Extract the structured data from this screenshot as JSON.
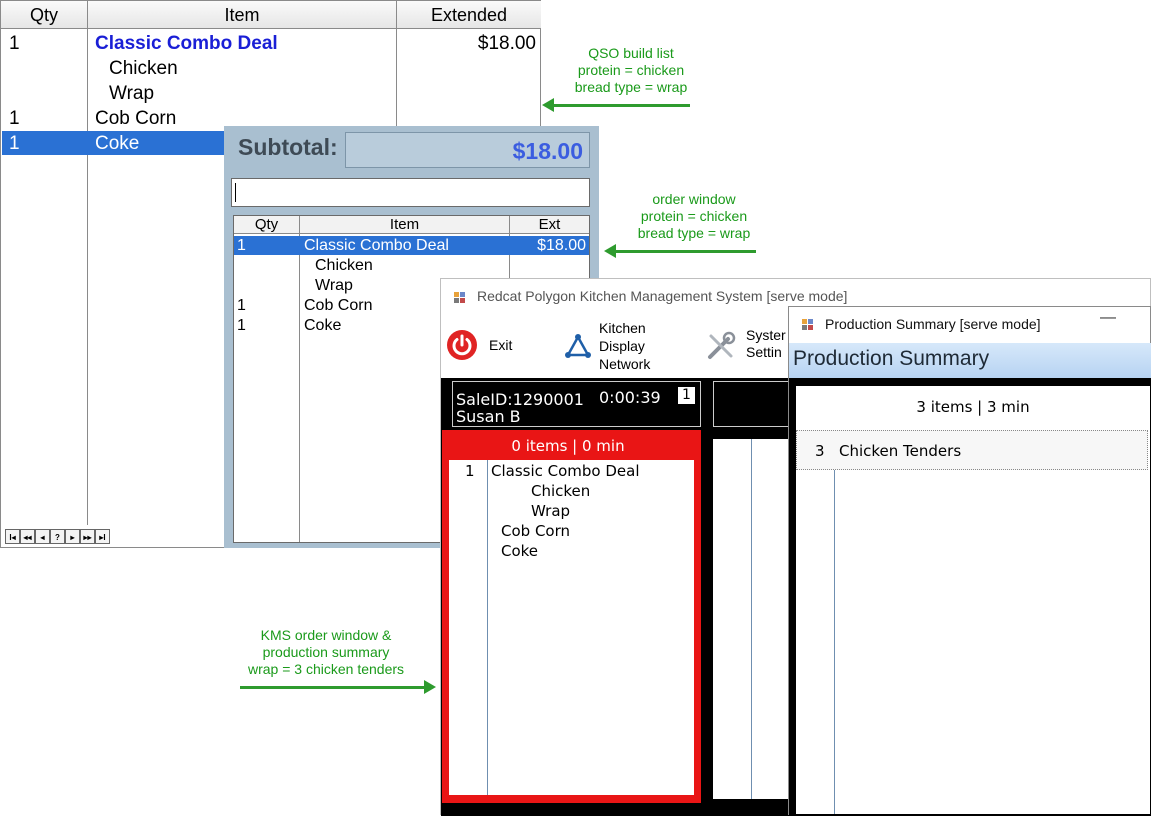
{
  "build_list": {
    "headers": [
      "Qty",
      "Item",
      "Extended"
    ],
    "rows": [
      {
        "qty": "1",
        "item": "Classic Combo Deal",
        "extended": "$18.00"
      },
      {
        "qty": "",
        "item": "Chicken",
        "extended": ""
      },
      {
        "qty": "",
        "item": "Wrap",
        "extended": ""
      },
      {
        "qty": "1",
        "item": "Cob Corn",
        "extended": ""
      },
      {
        "qty": "1",
        "item": "Coke",
        "extended": ""
      }
    ],
    "nav_buttons": [
      "I◂",
      "◂◂",
      "◂",
      "?",
      "▸",
      "▸▸",
      "▸I"
    ]
  },
  "order_window": {
    "subtotal_label": "Subtotal:",
    "subtotal_value": "$18.00",
    "headers": [
      "Qty",
      "Item",
      "Ext"
    ],
    "rows": [
      {
        "qty": "1",
        "item": "Classic Combo Deal",
        "ext": "$18.00"
      },
      {
        "qty": "",
        "item": "Chicken",
        "ext": ""
      },
      {
        "qty": "",
        "item": "Wrap",
        "ext": ""
      },
      {
        "qty": "1",
        "item": "Cob Corn",
        "ext": ""
      },
      {
        "qty": "1",
        "item": "Coke",
        "ext": ""
      }
    ]
  },
  "kms_window": {
    "title": "Redcat Polygon Kitchen Management System [serve mode]",
    "toolbar": {
      "exit": "Exit",
      "kitchen_display_network": [
        "Kitchen",
        "Display",
        "Network"
      ],
      "system_settings": [
        "Syster",
        "Settin"
      ]
    },
    "ticket": {
      "sale_id": "SaleID:1290001",
      "timer": "0:00:39",
      "number": "1",
      "server": "Susan B",
      "summary": "0 items |   0 min",
      "items": [
        {
          "qty": "1",
          "text": "Classic Combo Deal",
          "indent": 0
        },
        {
          "qty": "",
          "text": "Chicken",
          "indent": 2
        },
        {
          "qty": "",
          "text": "Wrap",
          "indent": 2
        },
        {
          "qty": "",
          "text": "Cob Corn",
          "indent": 1
        },
        {
          "qty": "",
          "text": "Coke",
          "indent": 1
        }
      ]
    }
  },
  "production_window": {
    "title": "Production Summary [serve mode]",
    "minimize": "—",
    "heading": "Production Summary",
    "summary": "3 items |   3 min",
    "rows": [
      {
        "qty": "3",
        "item": "Chicken Tenders"
      }
    ]
  },
  "annotations": {
    "qso": [
      "QSO build list",
      "protein = chicken",
      "bread type = wrap"
    ],
    "order": [
      "order window",
      "protein = chicken",
      "bread type = wrap"
    ],
    "kms": [
      "KMS order window &",
      "production summary",
      "wrap = 3 chicken tenders"
    ]
  },
  "colors": {
    "selection": "#2a71d4",
    "combo_text": "#1a1fd6",
    "subtotal_value": "#3b5de0",
    "ticket_red": "#e91515",
    "annotation_green": "#1a9a1a",
    "exit_red": "#e02424"
  }
}
